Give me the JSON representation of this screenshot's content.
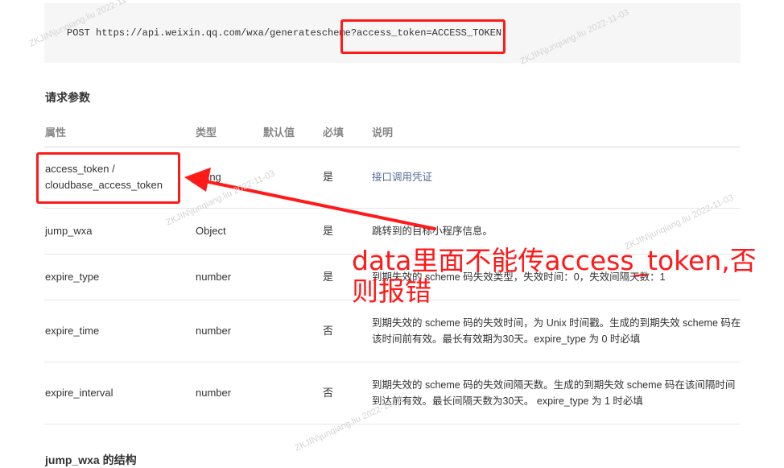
{
  "code": {
    "line": "POST https://api.weixin.qq.com/wxa/generatescheme?access_token=ACCESS_TOKEN"
  },
  "section_title": "请求参数",
  "table": {
    "headers": [
      "属性",
      "类型",
      "默认值",
      "必填",
      "说明"
    ],
    "rows": [
      {
        "name": "access_token / cloudbase_access_token",
        "type": "string",
        "default": "",
        "required": "是",
        "desc": "接口调用凭证"
      },
      {
        "name": "jump_wxa",
        "type": "Object",
        "default": "",
        "required": "是",
        "desc": "跳转到的目标小程序信息。"
      },
      {
        "name": "expire_type",
        "type": "number",
        "default": "",
        "required": "是",
        "desc": "到期失效的 scheme 码失效类型，失效时间：0，失效间隔天数：1"
      },
      {
        "name": "expire_time",
        "type": "number",
        "default": "",
        "required": "否",
        "desc": "到期失效的 scheme 码的失效时间，为 Unix 时间戳。生成的到期失效 scheme 码在该时间前有效。最长有效期为30天。expire_type 为 0 时必填"
      },
      {
        "name": "expire_interval",
        "type": "number",
        "default": "",
        "required": "否",
        "desc": "到期失效的 scheme 码的失效间隔天数。生成的到期失效 scheme 码在该间隔时间到达前有效。最长间隔天数为30天。 expire_type 为 1 时必填"
      }
    ]
  },
  "annotation": "data里面不能传access_token,否则报错",
  "next_heading": "jump_wxa 的结构",
  "watermark": "ZKJIN\\junqiang.liu  2022-11-03",
  "colors": {
    "highlight": "#ff1a1a",
    "link": "#576b95"
  }
}
